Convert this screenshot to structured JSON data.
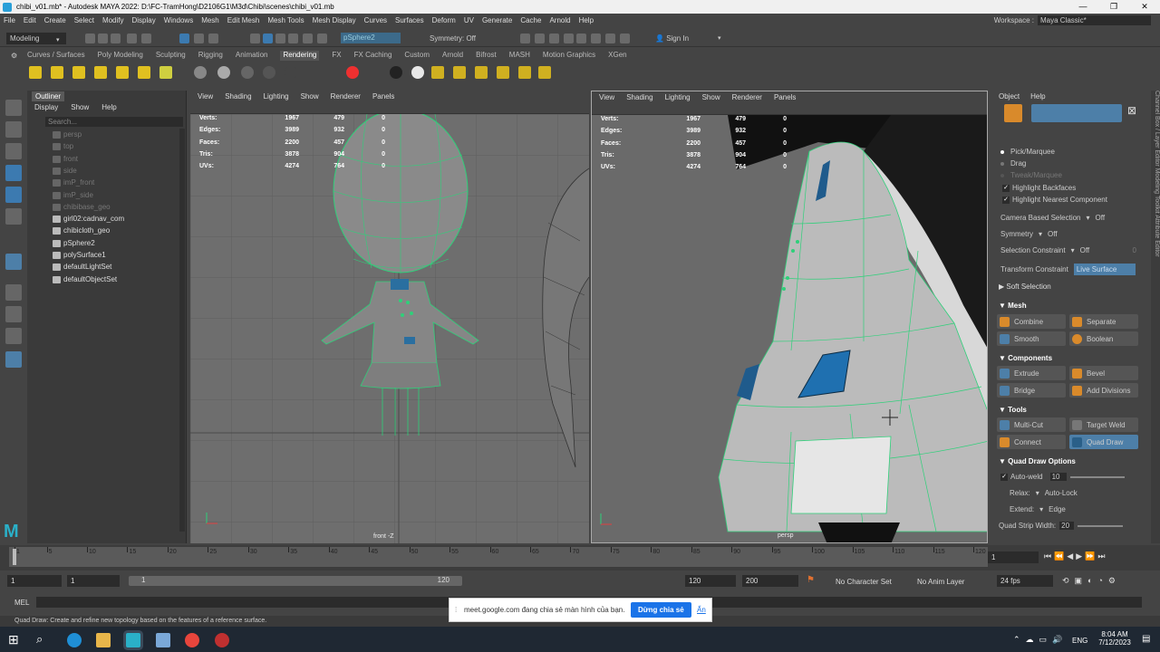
{
  "window": {
    "title": "chibi_v01.mb* - Autodesk MAYA 2022: D:\\FC-TramHong\\D2106G1\\M3d\\Chibi\\scenes\\chibi_v01.mb",
    "controls": [
      "—",
      "❐",
      "✕"
    ]
  },
  "menubar": [
    "File",
    "Edit",
    "Create",
    "Select",
    "Modify",
    "Display",
    "Windows",
    "Mesh",
    "Edit Mesh",
    "Mesh Tools",
    "Mesh Display",
    "Curves",
    "Surfaces",
    "Deform",
    "UV",
    "Generate",
    "Cache",
    "Arnold",
    "Help"
  ],
  "workspace": {
    "label": "Workspace :",
    "value": "Maya Classic*"
  },
  "statusline": {
    "mode": "Modeling",
    "object": "pSphere2",
    "symmetry": "Symmetry: Off",
    "signin": "Sign In"
  },
  "shelf_tabs": [
    "Curves / Surfaces",
    "Poly Modeling",
    "Sculpting",
    "Rigging",
    "Animation",
    "Rendering",
    "FX",
    "FX Caching",
    "Custom",
    "Arnold",
    "Bifrost",
    "MASH",
    "Motion Graphics",
    "XGen"
  ],
  "shelf_active": "Rendering",
  "outliner": {
    "tab": "Outliner",
    "menu": [
      "Display",
      "Show",
      "Help"
    ],
    "search": "Search...",
    "items": [
      {
        "label": "persp",
        "dim": true
      },
      {
        "label": "top",
        "dim": true
      },
      {
        "label": "front",
        "dim": true
      },
      {
        "label": "side",
        "dim": true
      },
      {
        "label": "imP_front",
        "dim": true
      },
      {
        "label": "imP_side",
        "dim": true
      },
      {
        "label": "chibibase_geo",
        "dim": true
      },
      {
        "label": "girl02:cadnav_com",
        "dim": false
      },
      {
        "label": "chibicloth_geo",
        "dim": false
      },
      {
        "label": "pSphere2",
        "dim": false
      },
      {
        "label": "polySurface1",
        "dim": false
      },
      {
        "label": "defaultLightSet",
        "dim": false
      },
      {
        "label": "defaultObjectSet",
        "dim": false
      }
    ]
  },
  "viewport_menu": [
    "View",
    "Shading",
    "Lighting",
    "Show",
    "Renderer",
    "Panels"
  ],
  "hud": {
    "rows": [
      {
        "k": "Verts:",
        "a": "1967",
        "b": "479",
        "c": "0"
      },
      {
        "k": "Edges:",
        "a": "3989",
        "b": "932",
        "c": "0"
      },
      {
        "k": "Faces:",
        "a": "2200",
        "b": "457",
        "c": "0"
      },
      {
        "k": "Tris:",
        "a": "3878",
        "b": "904",
        "c": "0"
      },
      {
        "k": "UVs:",
        "a": "4274",
        "b": "764",
        "c": "0"
      }
    ]
  },
  "viewport_left": {
    "label": "front -Z"
  },
  "viewport_right": {
    "label": "persp"
  },
  "modeling_toolkit": {
    "menu": [
      "Object",
      "Help"
    ],
    "pick": [
      "Pick/Marquee",
      "Drag",
      "Tweak/Marquee"
    ],
    "highlight_backfaces": "Highlight Backfaces",
    "highlight_nearest": "Highlight Nearest Component",
    "camera_sel": {
      "label": "Camera Based Selection",
      "value": "Off"
    },
    "symmetry": {
      "label": "Symmetry",
      "value": "Off"
    },
    "sel_constraint": {
      "label": "Selection Constraint",
      "value": "Off",
      "num": "0"
    },
    "transform_constraint": {
      "label": "Transform Constraint",
      "value": "Live Surface"
    },
    "soft": "Soft Selection",
    "mesh": {
      "title": "Mesh",
      "buttons": [
        "Combine",
        "Separate",
        "Smooth",
        "Boolean"
      ]
    },
    "components": {
      "title": "Components",
      "buttons": [
        "Extrude",
        "Bevel",
        "Bridge",
        "Add Divisions"
      ]
    },
    "tools": {
      "title": "Tools",
      "buttons": [
        "Multi-Cut",
        "Target Weld",
        "Connect",
        "Quad Draw"
      ]
    },
    "quad_opts": {
      "title": "Quad Draw Options",
      "autoweld": "Auto-weld",
      "autoweld_val": "10",
      "relax_label": "Relax:",
      "relax": "Auto-Lock",
      "extend_label": "Extend:",
      "extend": "Edge",
      "strip_label": "Quad Strip Width:",
      "strip": "20"
    }
  },
  "sidetabs": "Channel Box / Layer Editor   Modeling Toolkit   Attribute Editor",
  "timeline": {
    "ticks": [
      "1",
      "5",
      "10",
      "15",
      "20",
      "25",
      "30",
      "35",
      "40",
      "45",
      "50",
      "55",
      "60",
      "65",
      "70",
      "75",
      "80",
      "85",
      "90",
      "95",
      "100",
      "105",
      "110",
      "115",
      "120"
    ],
    "current": "1"
  },
  "range": {
    "start": "1",
    "start2": "1",
    "slider_start": "1",
    "slider_end": "120",
    "end": "120",
    "end2": "200",
    "char_set": "No Character Set",
    "anim_layer": "No Anim Layer",
    "fps": "24 fps"
  },
  "cmd": {
    "label": "MEL"
  },
  "help": "Quad Draw: Create and refine new topology based on the features of a reference surface.",
  "share": {
    "text": "meet.google.com đang chia sẻ màn hình của bạn.",
    "stop": "Dừng chia sẻ",
    "hide": "Ẩn"
  },
  "taskbar": {
    "lang": "ENG",
    "time": "8:04 AM",
    "date": "7/12/2023"
  }
}
